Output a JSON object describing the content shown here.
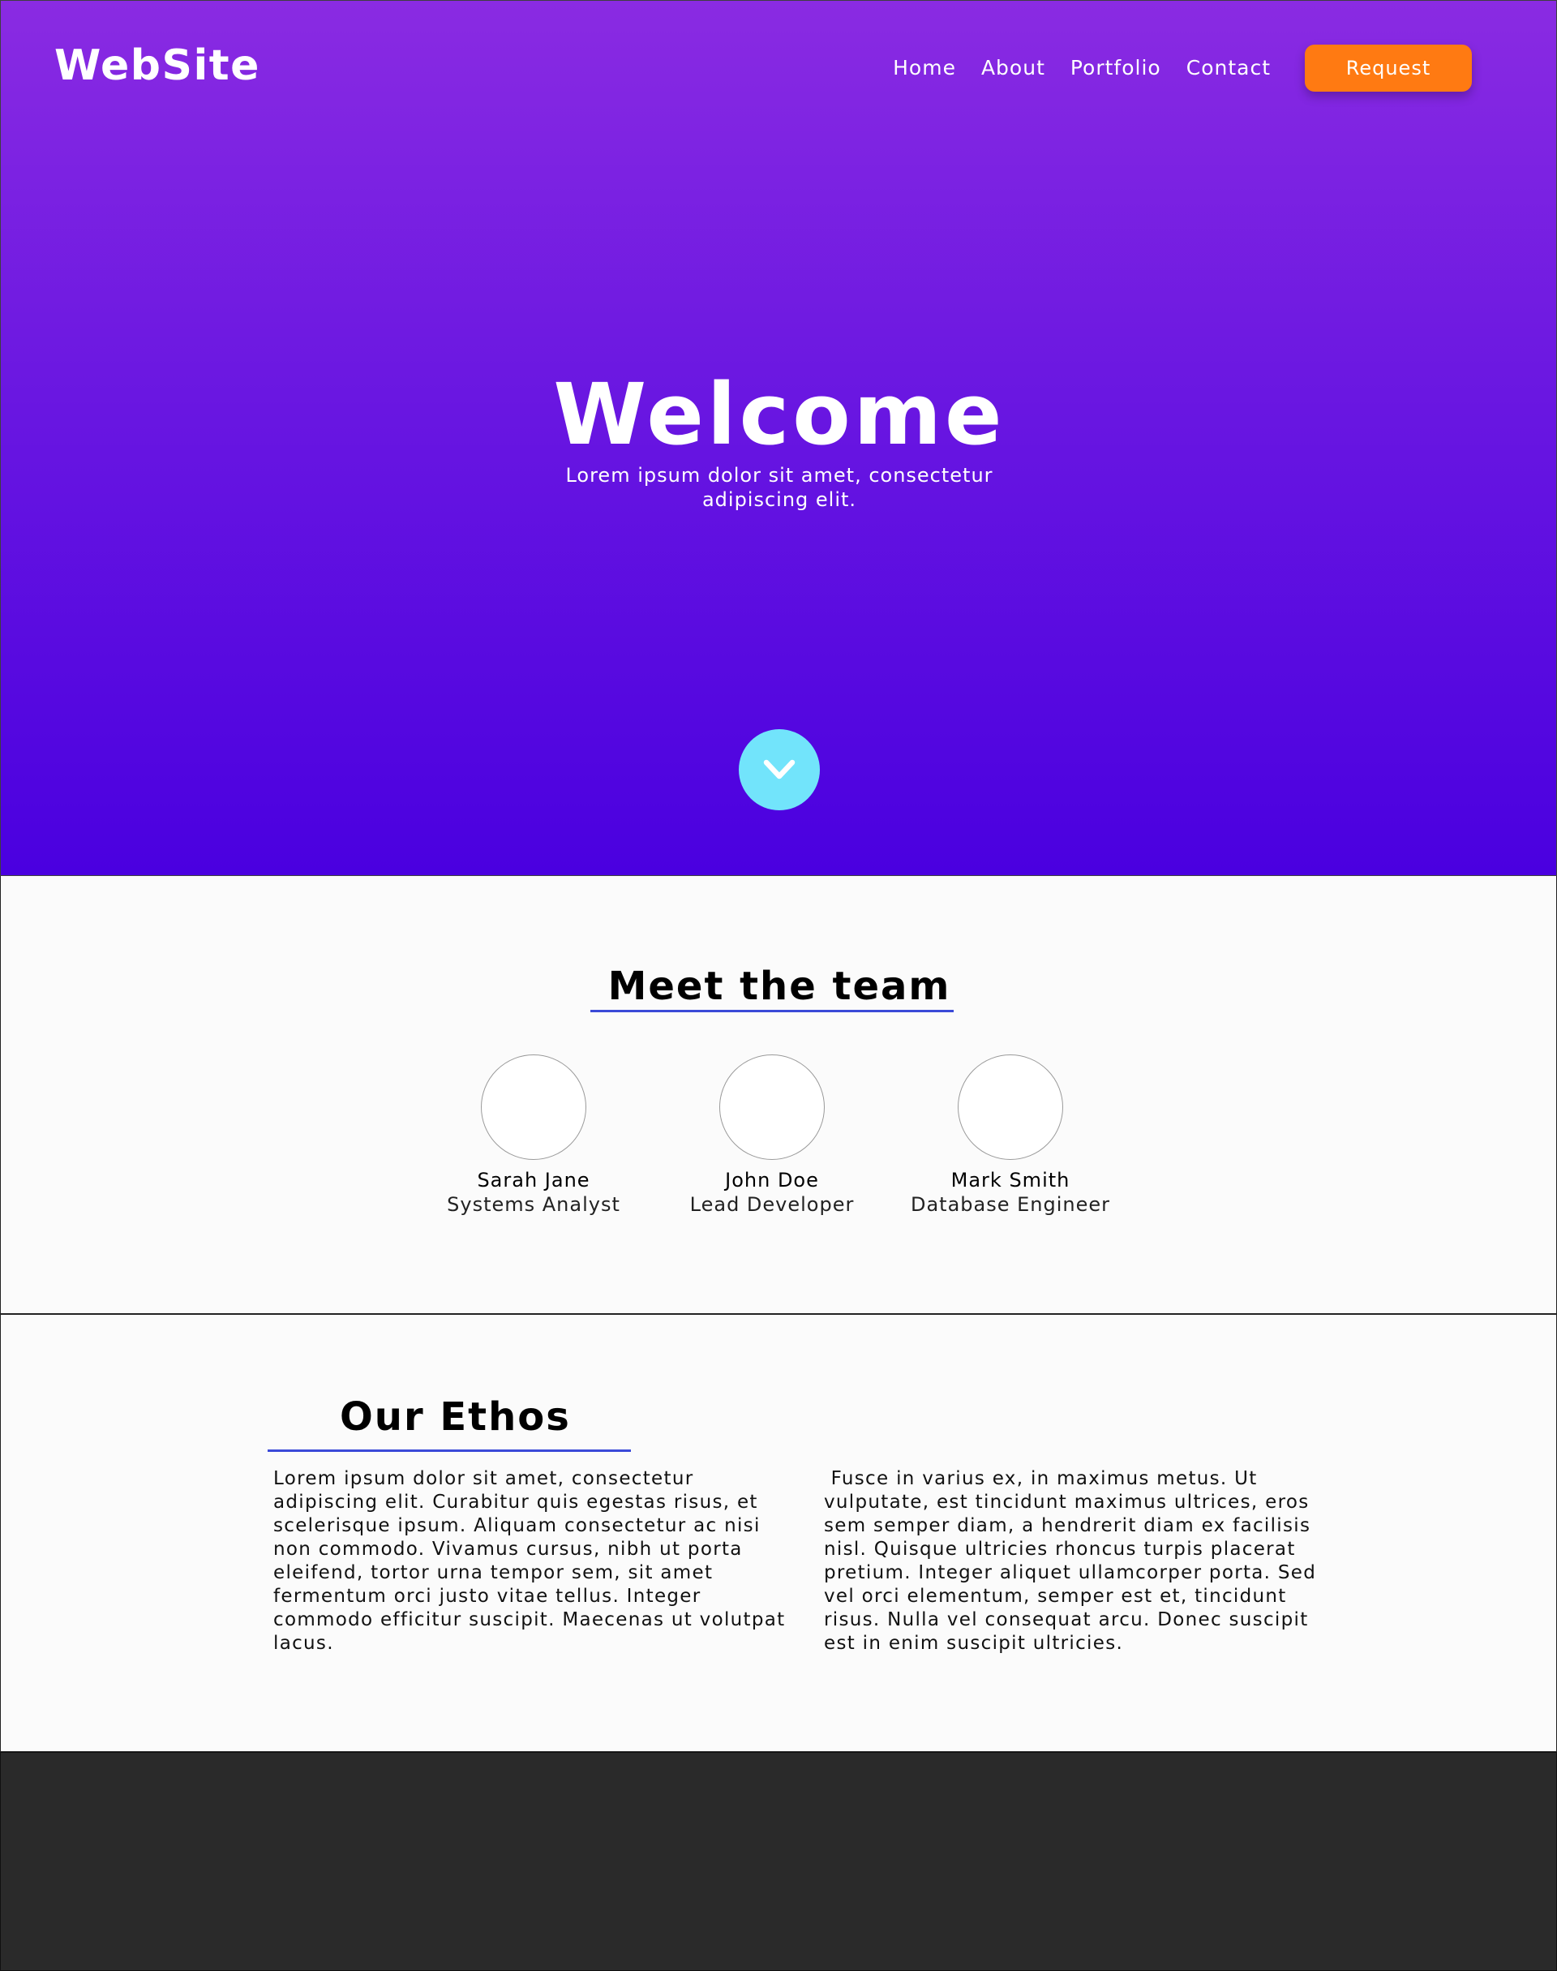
{
  "header": {
    "logo": "WebSite",
    "nav": [
      "Home",
      "About",
      "Portfolio",
      "Contact"
    ],
    "request_label": "Request"
  },
  "hero": {
    "title": "Welcome",
    "subtitle": "Lorem ipsum dolor sit amet, consectetur adipiscing elit.",
    "scroll_icon": "chevron-down-icon"
  },
  "team": {
    "title": "Meet the team",
    "members": [
      {
        "name": "Sarah Jane",
        "role": "Systems Analyst"
      },
      {
        "name": "John Doe",
        "role": "Lead Developer"
      },
      {
        "name": "Mark Smith",
        "role": "Database Engineer"
      }
    ]
  },
  "ethos": {
    "title": "Our Ethos",
    "col1": "Lorem ipsum dolor sit amet, consectetur adipiscing elit. Curabitur quis egestas risus, et scelerisque ipsum. Aliquam consectetur ac nisi non commodo. Vivamus cursus, nibh ut porta eleifend, tortor urna tempor sem, sit amet fermentum orci justo vitae tellus. Integer commodo efficitur suscipit. Maecenas ut volutpat lacus.",
    "col2": " Fusce in varius ex, in maximus metus. Ut vulputate, est tincidunt maximus ultrices, eros sem semper diam, a hendrerit diam ex facilisis nisl. Quisque ultricies rhoncus turpis placerat pretium. Integer aliquet ullamcorper porta. Sed vel orci elementum, semper est et, tincidunt risus. Nulla vel consequat arcu. Donec suscipit est in enim suscipit ultricies."
  },
  "colors": {
    "hero_top": "#8a2be2",
    "hero_bottom": "#4a00e0",
    "accent": "#ff7a12",
    "scroll_button": "#72e4fb",
    "underline": "#3b4ad8",
    "footer": "#2a2a2a"
  }
}
